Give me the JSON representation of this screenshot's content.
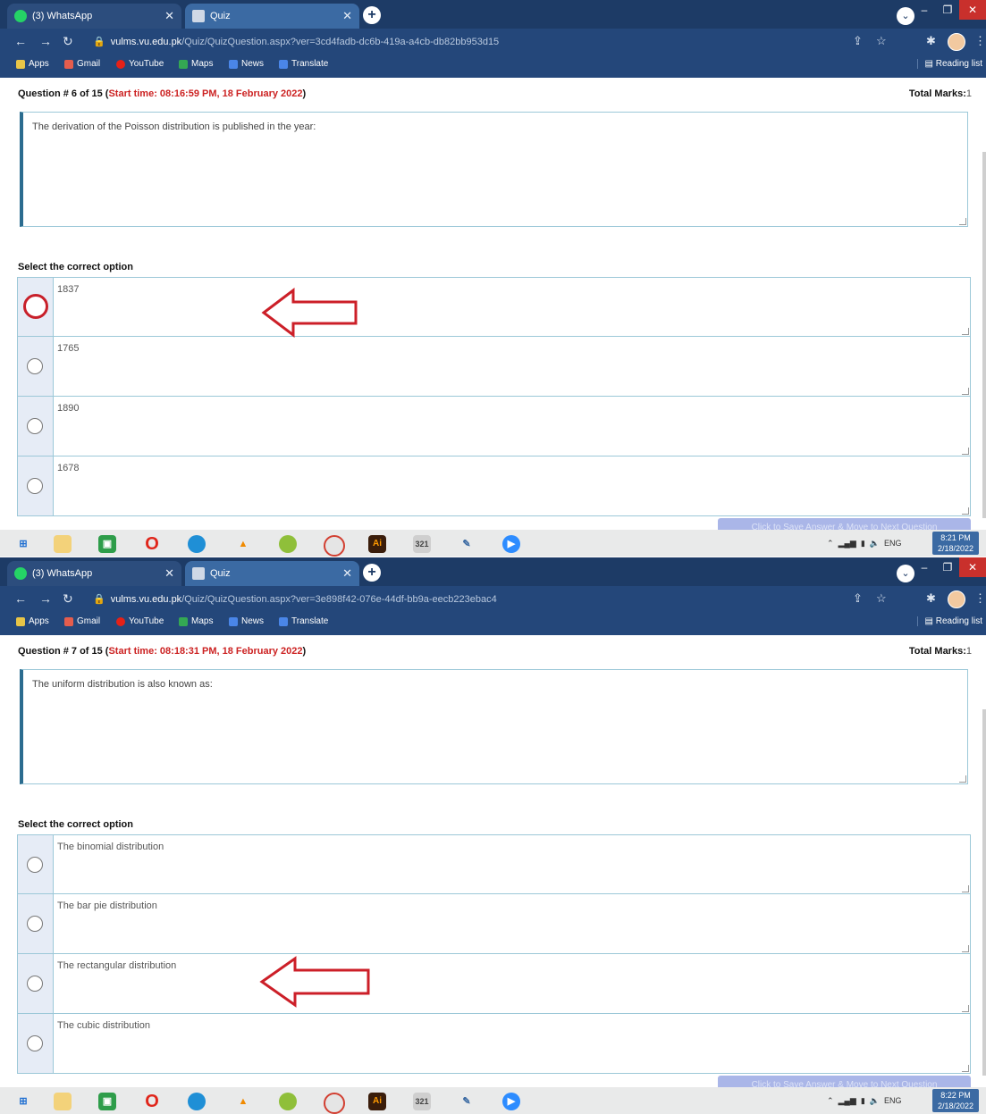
{
  "colors": {
    "tab_bar": "#1d3b66",
    "address_bar": "#24477a",
    "accent_red": "#cc2222",
    "option_border": "#9cc8d8",
    "next_button": "#aab6e8"
  },
  "browser": {
    "tabs": [
      "(3) WhatsApp",
      "Quiz"
    ],
    "bookmarks": [
      "Apps",
      "Gmail",
      "YouTube",
      "Maps",
      "News",
      "Translate"
    ],
    "reading_list": "Reading list"
  },
  "taskbar": {
    "lang": "ENG"
  },
  "common": {
    "select_label": "Select the correct option",
    "total_marks_label": "Total Marks:",
    "total_marks_value": "1",
    "next_button": "Click to Save Answer & Move to Next Question"
  },
  "screens": [
    {
      "url_host": "vulms.vu.edu.pk",
      "url_path": "/Quiz/QuizQuestion.aspx?ver=3cd4fadb-dc6b-419a-a4cb-db82bb953d15",
      "question_prefix": "Question # 6 of 15 (",
      "start_time": "Start time: 08:16:59 PM, 18 February 2022",
      "question_suffix": ")",
      "question_text": "The derivation of the Poisson distribution is published in the year:",
      "options": [
        "1837",
        "1765",
        "1890",
        "1678"
      ],
      "clock_time": "8:21 PM",
      "clock_date": "2/18/2022"
    },
    {
      "url_host": "vulms.vu.edu.pk",
      "url_path": "/Quiz/QuizQuestion.aspx?ver=3e898f42-076e-44df-bb9a-eecb223ebac4",
      "question_prefix": "Question # 7 of 15 (",
      "start_time": "Start time: 08:18:31 PM, 18 February 2022",
      "question_suffix": ")",
      "question_text": "The uniform distribution is also known as:",
      "options": [
        "The binomial distribution",
        "The bar pie distribution",
        "The rectangular distribution",
        "The cubic distribution"
      ],
      "clock_time": "8:22 PM",
      "clock_date": "2/18/2022"
    }
  ]
}
